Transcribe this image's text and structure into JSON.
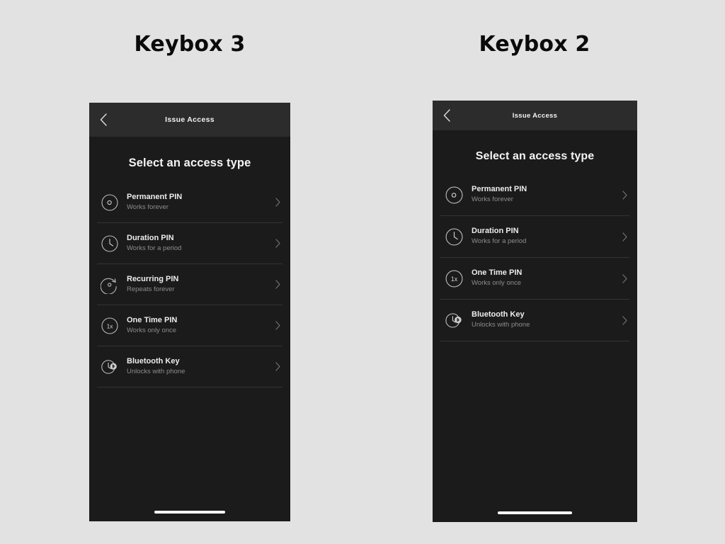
{
  "background_color": "#e2e2e2",
  "columns": [
    {
      "title": "Keybox 3",
      "phone": {
        "navbar": {
          "back_icon": "chevron-left-icon",
          "title": "Issue Access"
        },
        "heading": "Select an access type",
        "items": [
          {
            "icon": "infinity-circle-icon",
            "title": "Permanent PIN",
            "subtitle": "Works forever",
            "chevron": "chevron-right-icon"
          },
          {
            "icon": "clock-circle-icon",
            "title": "Duration PIN",
            "subtitle": "Works for a period",
            "chevron": "chevron-right-icon"
          },
          {
            "icon": "recurring-loop-icon",
            "title": "Recurring PIN",
            "subtitle": "Repeats forever",
            "chevron": "chevron-right-icon"
          },
          {
            "icon": "one-times-circle-icon",
            "title": "One Time PIN",
            "subtitle": "Works only once",
            "chevron": "chevron-right-icon"
          },
          {
            "icon": "bluetooth-clock-icon",
            "title": "Bluetooth Key",
            "subtitle": "Unlocks with phone",
            "chevron": "chevron-right-icon"
          }
        ],
        "home_indicator": "home-indicator"
      }
    },
    {
      "title": "Keybox 2",
      "phone": {
        "navbar": {
          "back_icon": "chevron-left-icon",
          "title": "Issue Access"
        },
        "heading": "Select an access type",
        "items": [
          {
            "icon": "infinity-circle-icon",
            "title": "Permanent PIN",
            "subtitle": "Works forever",
            "chevron": "chevron-right-icon"
          },
          {
            "icon": "clock-circle-icon",
            "title": "Duration PIN",
            "subtitle": "Works for a period",
            "chevron": "chevron-right-icon"
          },
          {
            "icon": "one-times-circle-icon",
            "title": "One Time PIN",
            "subtitle": "Works only once",
            "chevron": "chevron-right-icon"
          },
          {
            "icon": "bluetooth-clock-icon",
            "title": "Bluetooth Key",
            "subtitle": "Unlocks with phone",
            "chevron": "chevron-right-icon"
          }
        ],
        "home_indicator": "home-indicator"
      }
    }
  ],
  "theme": {
    "screen_bg": "#1b1b1b",
    "navbar_bg": "#2c2c2c",
    "title_text": "#ededed",
    "subtitle_text": "#8d8d8d",
    "divider": "#343434",
    "icon_stroke": "#b9b9b9",
    "chevron": "#6e6e6e",
    "heading_text": "#f4f4f4"
  }
}
